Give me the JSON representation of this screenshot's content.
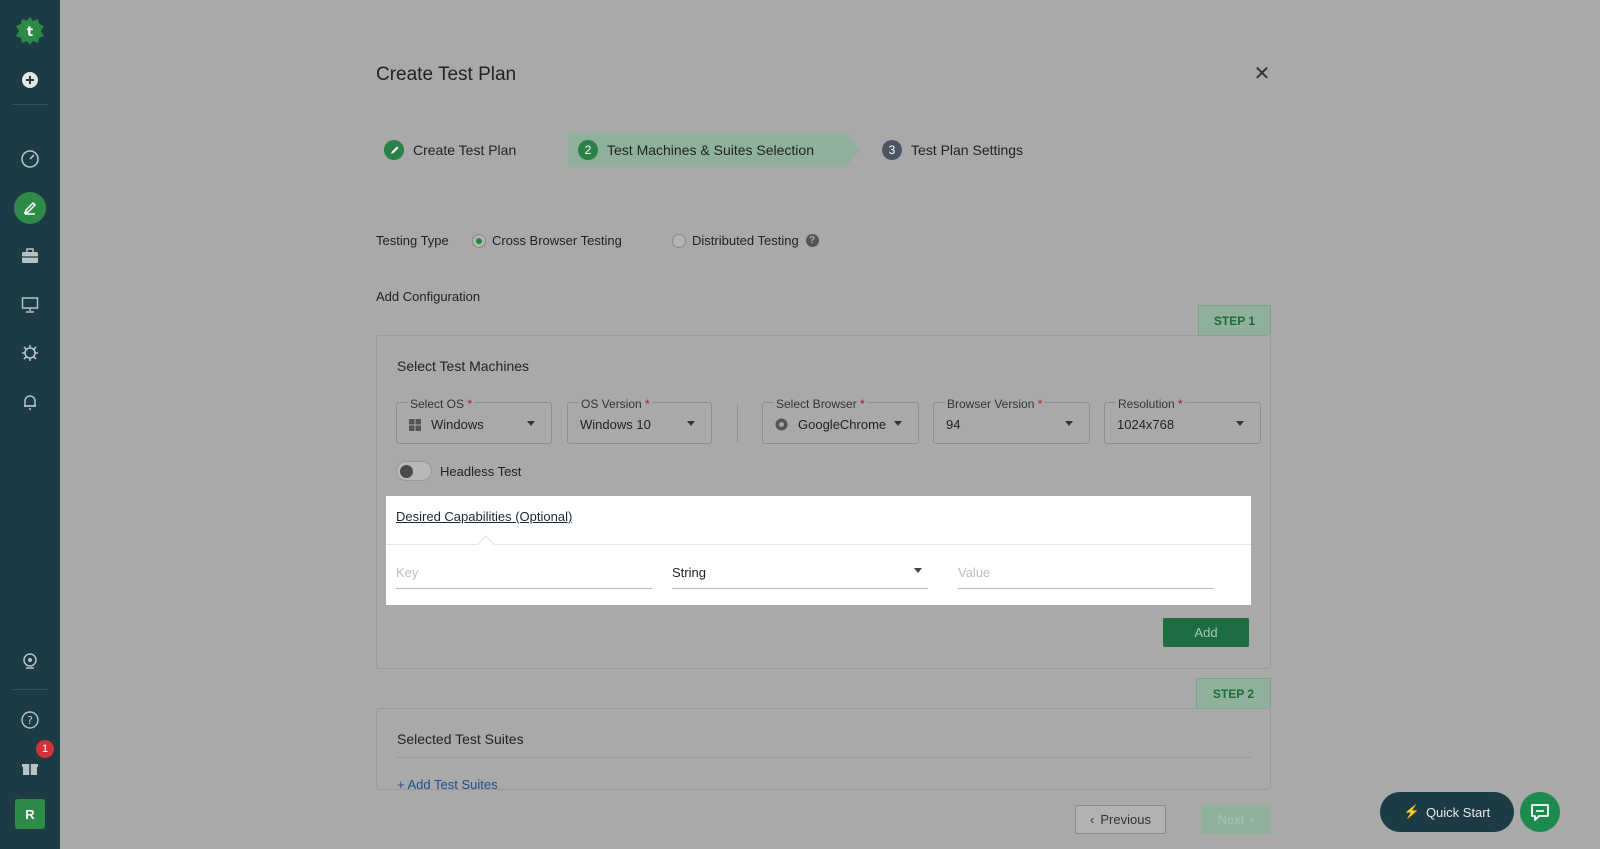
{
  "sidebar": {
    "items": [
      {
        "icon": "logo-icon"
      },
      {
        "icon": "add-icon"
      },
      {
        "icon": "dashboard-icon"
      },
      {
        "icon": "edit-icon",
        "active": true
      },
      {
        "icon": "briefcase-icon"
      },
      {
        "icon": "monitor-icon"
      },
      {
        "icon": "settings-bug-icon"
      },
      {
        "icon": "bell-icon"
      },
      {
        "icon": "agent-icon"
      },
      {
        "icon": "help-icon"
      },
      {
        "icon": "gift-icon",
        "badge": "1"
      }
    ],
    "avatar": "R"
  },
  "dialog": {
    "title": "Create Test Plan",
    "steps": [
      {
        "num": "",
        "label": "Create Test Plan"
      },
      {
        "num": "2",
        "label": "Test Machines & Suites Selection"
      },
      {
        "num": "3",
        "label": "Test Plan Settings"
      }
    ],
    "testing_type": {
      "label": "Testing Type",
      "options": [
        "Cross Browser Testing",
        "Distributed Testing"
      ],
      "selected": "Cross Browser Testing"
    },
    "add_configuration": "Add Configuration",
    "step1_tag": "STEP 1",
    "step2_tag": "STEP 2",
    "machines": {
      "title": "Select Test Machines",
      "os": {
        "label": "Select OS",
        "value": "Windows"
      },
      "os_version": {
        "label": "OS Version",
        "value": "Windows 10"
      },
      "browser": {
        "label": "Select Browser",
        "value": "GoogleChrome"
      },
      "browser_version": {
        "label": "Browser Version",
        "value": "94"
      },
      "resolution": {
        "label": "Resolution",
        "value": "1024x768"
      },
      "required_mark": "*",
      "headless_label": "Headless Test",
      "headless_on": false
    },
    "capabilities": {
      "title": "Desired Capabilities (Optional)",
      "key_placeholder": "Key",
      "type_value": "String",
      "value_placeholder": "Value",
      "add_label": "Add"
    },
    "suites": {
      "title": "Selected Test Suites",
      "add_link": "+ Add Test Suites"
    },
    "footer": {
      "previous": "Previous",
      "next": "Next"
    }
  },
  "floating": {
    "quick_start": "Quick Start"
  },
  "colors": {
    "sidebar_bg": "#1c3b45",
    "accent_green": "#2e8b47",
    "overlay_bg": "#a9a9a9"
  }
}
